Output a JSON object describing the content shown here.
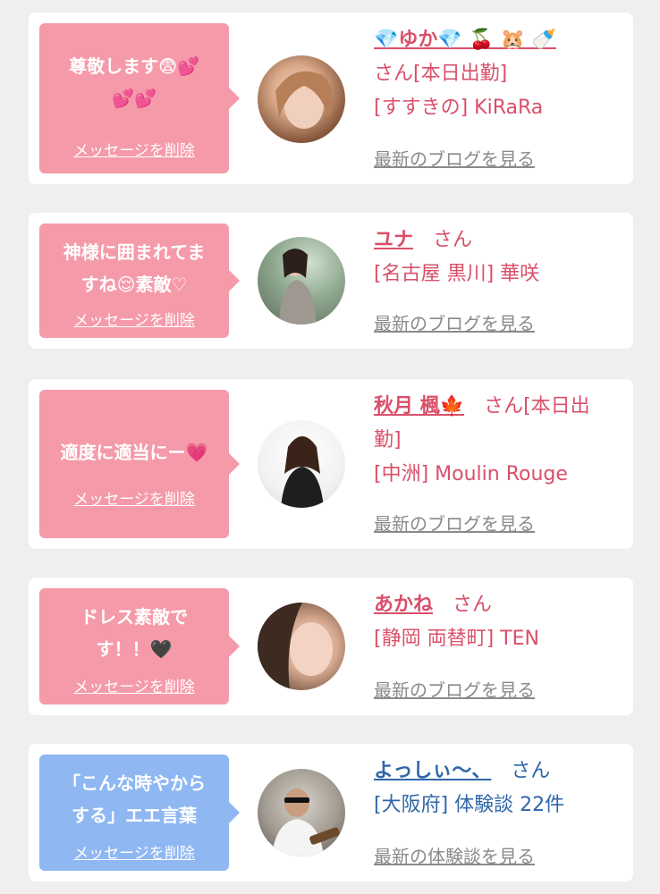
{
  "delete_label": "メッセージを削除",
  "cards": [
    {
      "message_lines": [
        "尊敬します😨💕",
        "💕💕"
      ],
      "name": "💎ゆか💎 🍒 🐹 🍼",
      "san": "さん[本日出勤]",
      "shop": "[すすきの] KiRaRa",
      "blog": "最新のブログを見る"
    },
    {
      "message_lines": [
        "神様に囲まれてま",
        "すね😌素敵♡"
      ],
      "name": "ユナ",
      "san": "さん",
      "shop": "[名古屋 黒川] 華咲",
      "blog": "最新のブログを見る"
    },
    {
      "message_lines": [
        "適度に適当にー💗"
      ],
      "name": "秋月 楓🍁",
      "san_line1": "さん[本日出",
      "san_line2": "勤]",
      "shop": "[中洲] Moulin Rouge",
      "blog": "最新のブログを見る"
    },
    {
      "message_lines": [
        "ドレス素敵で",
        "す！！🖤"
      ],
      "name": "あかね",
      "san": "さん",
      "shop": "[静岡 両替町] TEN",
      "blog": "最新のブログを見る"
    },
    {
      "message_lines": [
        "「こんな時やから",
        "する」エエ言葉"
      ],
      "name": "よっしぃ〜、",
      "san": "さん",
      "shop": "[大阪府] 体験談 22件",
      "blog": "最新の体験談を見る"
    }
  ],
  "colors": {
    "page_bg": "#efefef",
    "bubble_pink": "#f59aa9",
    "bubble_blue": "#8fb7f2",
    "name_pink": "#d9506a",
    "name_blue": "#2f67a8"
  }
}
